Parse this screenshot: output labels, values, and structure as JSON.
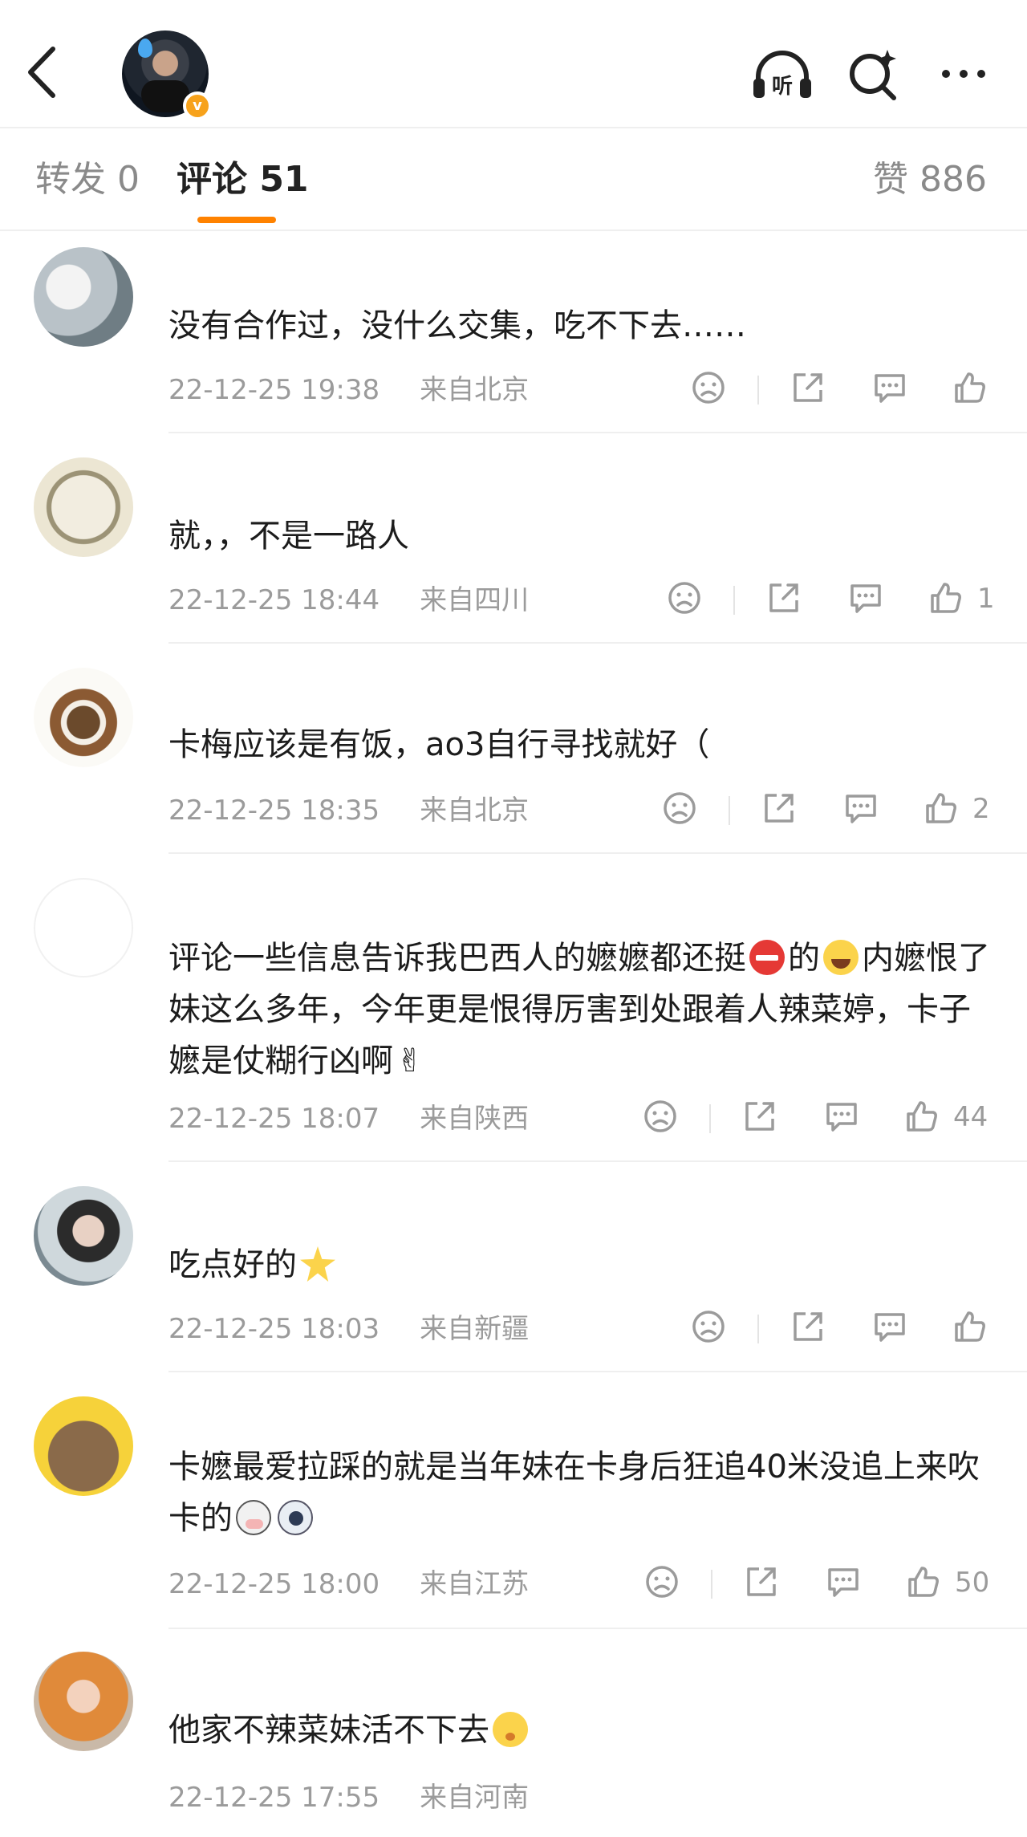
{
  "header": {
    "back_icon": "chevron-left-icon",
    "listen_label": "听",
    "search_icon": "search-sparkle-icon",
    "more_icon": "more-dots-icon"
  },
  "tabs": {
    "repost": "转发 0",
    "comments": "评论 51",
    "likes": "赞 886"
  },
  "colors": {
    "accent": "#ff8200",
    "meta": "#9b9b9b",
    "badge": "#f7a21b"
  },
  "comments": [
    {
      "text": "没有合作过，没什么交集，吃不下去……",
      "date": "22-12-25 19:38",
      "location": "来自北京",
      "likes": ""
    },
    {
      "text": "就，，不是一路人",
      "date": "22-12-25 18:44",
      "location": "来自四川",
      "likes": "1"
    },
    {
      "text": "卡梅应该是有饭，ao3自行寻找就好（",
      "date": "22-12-25 18:35",
      "location": "来自北京",
      "likes": "2"
    },
    {
      "text_parts": [
        "评论一些信息告诉我巴西人的嬷嬷都还挺",
        "的",
        "内嬷恨了妹这么多年，今年更是恨得厉害到处跟着人辣菜婷，卡子嬷是仗糊行凶啊"
      ],
      "date": "22-12-25 18:07",
      "location": "来自陕西",
      "likes": "44"
    },
    {
      "text": "吃点好的",
      "date": "22-12-25 18:03",
      "location": "来自新疆",
      "likes": ""
    },
    {
      "text": "卡嬷最爱拉踩的就是当年妹在卡身后狂追40米没追上来吹卡的",
      "date": "22-12-25 18:00",
      "location": "来自江苏",
      "likes": "50"
    },
    {
      "text": "他家不辣菜妹活不下去",
      "date": "22-12-25 17:55",
      "location": "来自河南",
      "likes": ""
    }
  ]
}
